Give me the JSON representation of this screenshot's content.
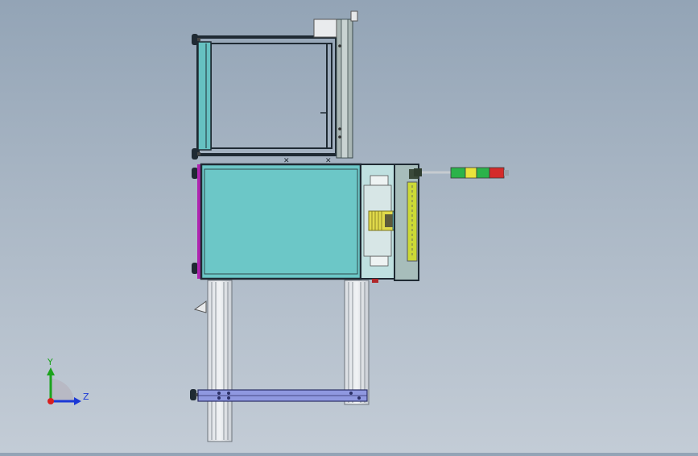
{
  "viewport": {
    "background_top": "#93a4b6",
    "background_bottom": "#c3ccd6"
  },
  "triad": {
    "y_label": "Y",
    "z_label": "Z",
    "y_color": "#1ca31c",
    "z_color": "#1a38d6",
    "x_color": "#d81f1f"
  },
  "model": {
    "cabinet_color": "#6cc7c7",
    "frame_color": "#1f2a33",
    "accent_color": "#b024b0",
    "rail_color": "#8f98e0",
    "signal_tower_colors": [
      "#2bb34a",
      "#e9e33c",
      "#2bb34a",
      "#d42a2a"
    ]
  }
}
